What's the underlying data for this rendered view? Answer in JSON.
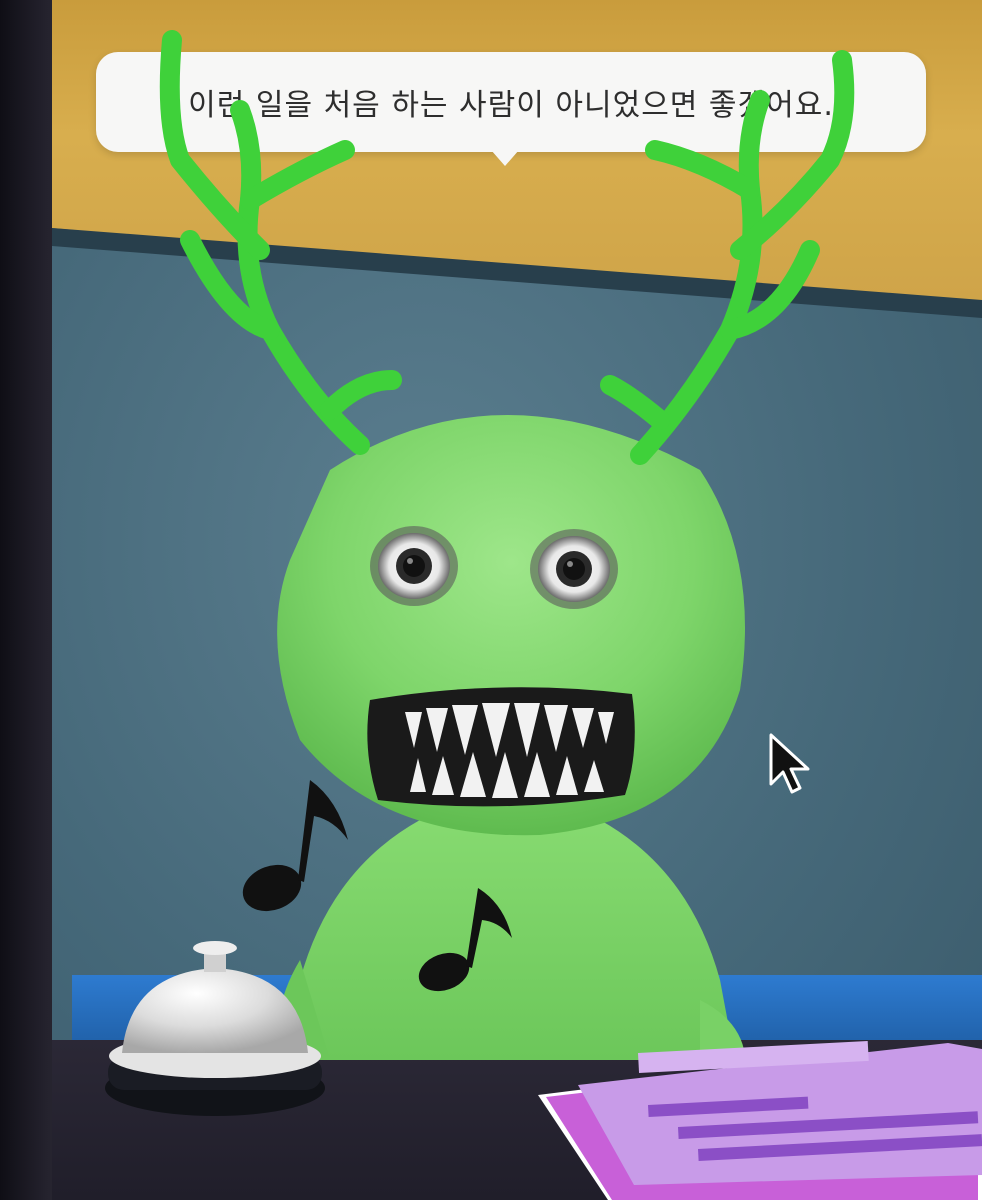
{
  "dialogue": {
    "text": "이런 일을 처음 하는 사람이 아니었으면 좋겠어요."
  },
  "colors": {
    "character_green": "#7ed56a",
    "antler_green": "#3fd13a",
    "wall_yellow": "#d8ae4e",
    "wall_teal": "#4a6d7e",
    "counter_blue": "#2e7bd0",
    "clipboard_purple": "#c89be8"
  },
  "icons": {
    "cursor": "mouse-pointer-icon",
    "bell": "service-bell-icon",
    "note": "music-note-icon",
    "clipboard": "clipboard-icon"
  }
}
